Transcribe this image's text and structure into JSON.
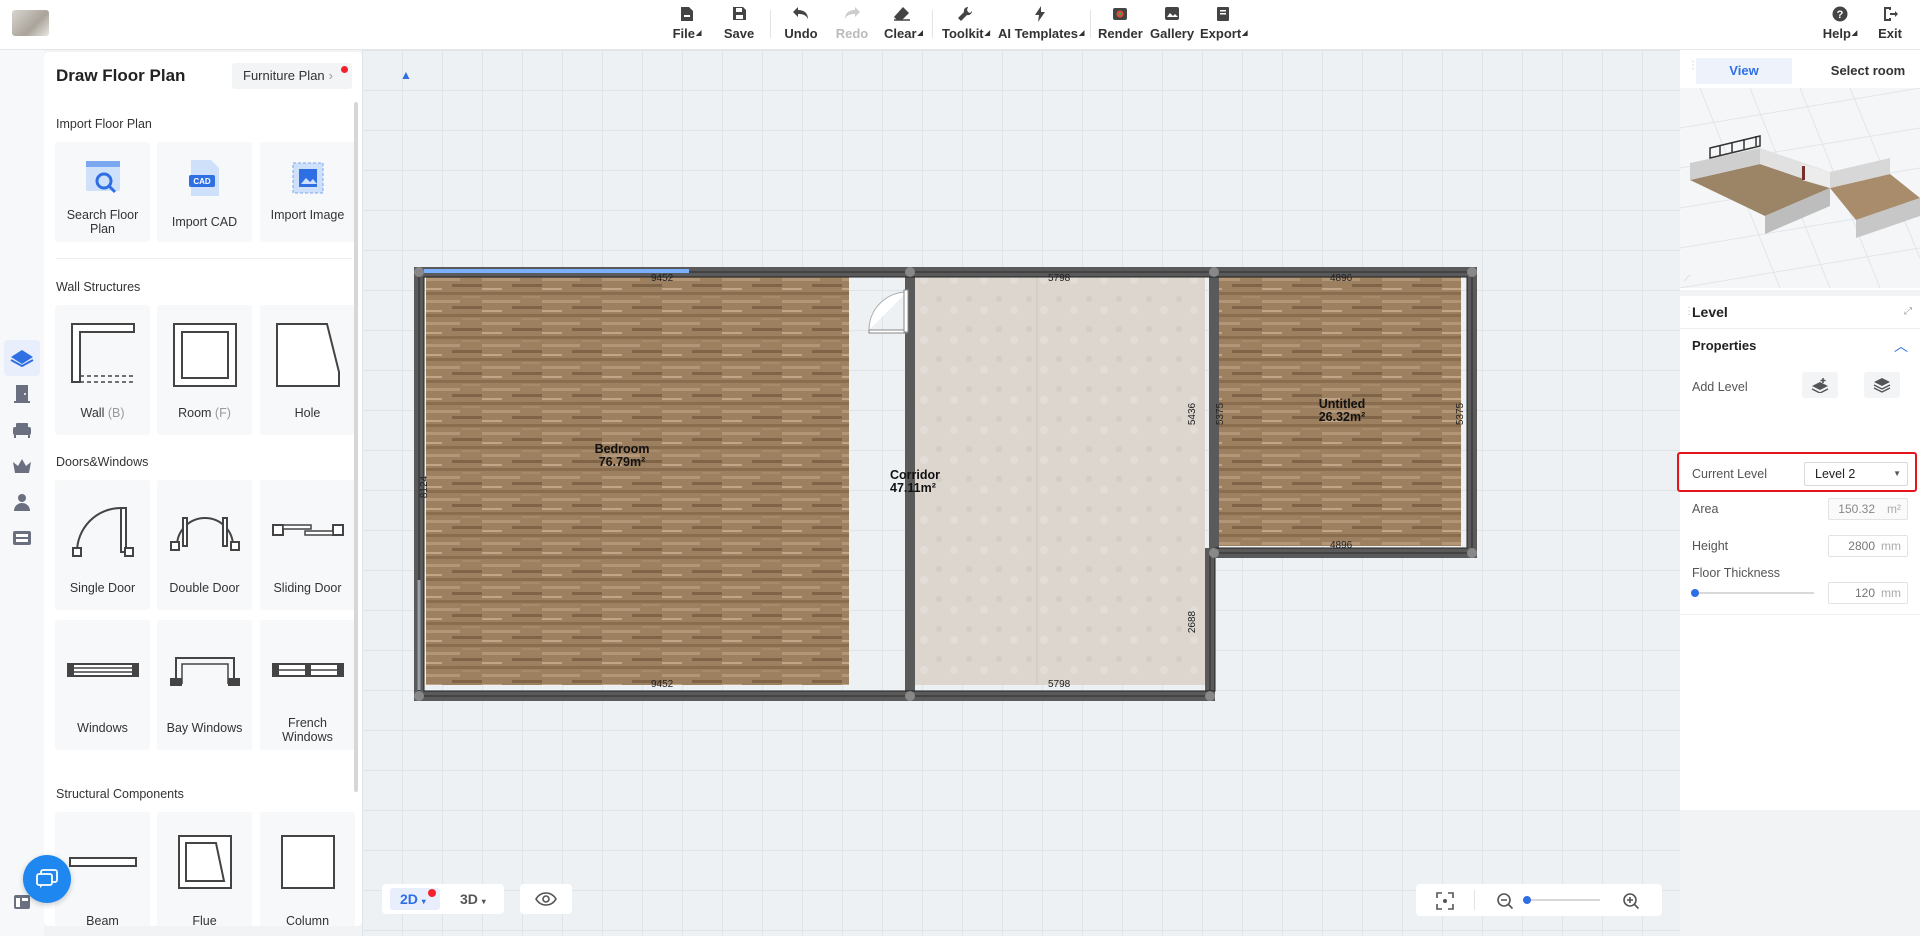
{
  "toolbar": {
    "file": "File",
    "save": "Save",
    "undo": "Undo",
    "redo": "Redo",
    "clear": "Clear",
    "toolkit": "Toolkit",
    "ai_templates": "AI Templates",
    "render": "Render",
    "gallery": "Gallery",
    "export": "Export",
    "help": "Help",
    "exit": "Exit"
  },
  "panel": {
    "title": "Draw Floor Plan",
    "furniture_plan": "Furniture Plan",
    "sections": {
      "import": "Import Floor Plan",
      "walls": "Wall Structures",
      "doors": "Doors&Windows",
      "structural": "Structural Components"
    },
    "import_items": [
      "Search Floor Plan",
      "Import CAD",
      "Import Image"
    ],
    "cad_badge": "CAD",
    "wall_items": [
      {
        "label": "Wall",
        "key": "(B)"
      },
      {
        "label": "Room",
        "key": "(F)"
      },
      {
        "label": "Hole",
        "key": ""
      }
    ],
    "door_items": [
      "Single Door",
      "Double Door",
      "Sliding Door"
    ],
    "window_items": [
      "Windows",
      "Bay Windows",
      "French Windows"
    ],
    "structural_items": [
      "Beam",
      "Flue",
      "Column"
    ]
  },
  "floorplan": {
    "rooms": [
      {
        "name": "Bedroom",
        "area": "76.79m²"
      },
      {
        "name": "Corridor",
        "area": "47.11m²"
      },
      {
        "name": "Untitled",
        "area": "26.32m²"
      }
    ],
    "dimensions": {
      "bedroom_top": "9452",
      "bedroom_bottom": "9452",
      "bedroom_left": "8124",
      "corridor_top": "5798",
      "corridor_bottom": "5798",
      "corridor_right_upper": "5436",
      "corridor_right_lower": "2688",
      "untitled_top": "4896",
      "untitled_bottom": "4896",
      "untitled_left": "5375",
      "untitled_right": "5375"
    }
  },
  "bottom": {
    "view_2d": "2D",
    "view_3d": "3D"
  },
  "right_panel": {
    "tab_view": "View",
    "tab_select_room": "Select room",
    "level_title": "Level",
    "properties": "Properties",
    "add_level": "Add Level",
    "current_level_label": "Current Level",
    "current_level_value": "Level 2",
    "area_label": "Area",
    "area_value": "150.32",
    "area_unit": "m²",
    "height_label": "Height",
    "height_value": "2800",
    "height_unit": "mm",
    "floor_thickness_label": "Floor Thickness",
    "floor_thickness_value": "120",
    "floor_thickness_unit": "mm",
    "floor_thickness_slider": 0.0
  },
  "colors": {
    "accent": "#2f6fe4",
    "highlight": "#e5151b",
    "badge_red": "#f5222d"
  }
}
